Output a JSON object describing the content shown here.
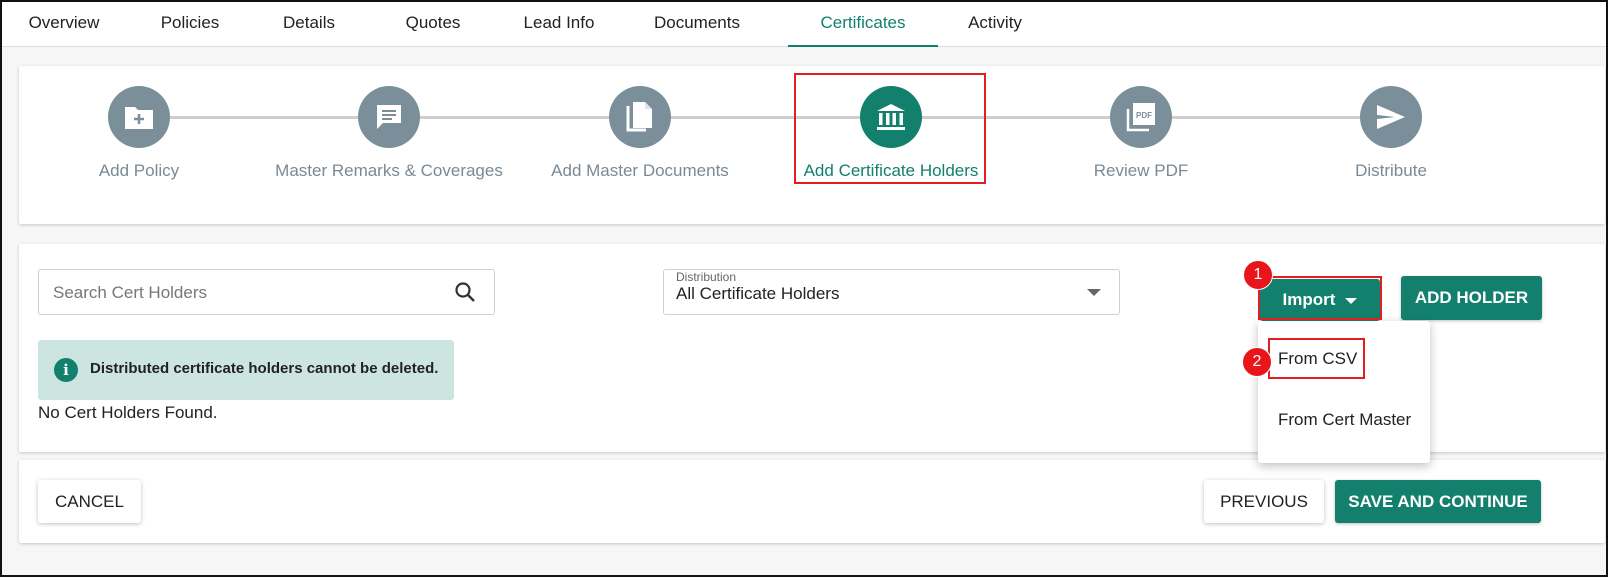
{
  "tabs": [
    {
      "label": "Overview"
    },
    {
      "label": "Policies"
    },
    {
      "label": "Details"
    },
    {
      "label": "Quotes"
    },
    {
      "label": "Lead Info"
    },
    {
      "label": "Documents"
    },
    {
      "label": "Certificates",
      "active": true
    },
    {
      "label": "Activity"
    }
  ],
  "stepper": {
    "steps": [
      {
        "label": "Add Policy",
        "icon": "folder-plus-icon"
      },
      {
        "label": "Master Remarks & Coverages",
        "icon": "comment-icon"
      },
      {
        "label": "Add Master Documents",
        "icon": "documents-icon"
      },
      {
        "label": "Add Certificate Holders",
        "icon": "bank-icon",
        "active": true
      },
      {
        "label": "Review PDF",
        "icon": "pdf-icon"
      },
      {
        "label": "Distribute",
        "icon": "send-icon"
      }
    ]
  },
  "search": {
    "placeholder": "Search Cert Holders",
    "value": ""
  },
  "distribution": {
    "label": "Distribution",
    "value": "All Certificate Holders"
  },
  "import_button": {
    "label": "Import"
  },
  "import_menu": {
    "items": [
      "From CSV",
      "From Cert Master"
    ]
  },
  "add_holder_button": {
    "label": "ADD HOLDER"
  },
  "info_banner": {
    "text": "Distributed certificate holders cannot be deleted.",
    "icon_glyph": "i"
  },
  "empty_state": {
    "text": "No Cert Holders Found."
  },
  "footer": {
    "cancel": "CANCEL",
    "previous": "PREVIOUS",
    "save": "SAVE AND CONTINUE"
  },
  "annotations": {
    "marker_1": "1",
    "marker_2": "2"
  },
  "colors": {
    "accent": "#13806d",
    "inactive_step": "#7a8f99",
    "banner_bg": "#cde5e0",
    "annotation_red": "#e8161b"
  }
}
